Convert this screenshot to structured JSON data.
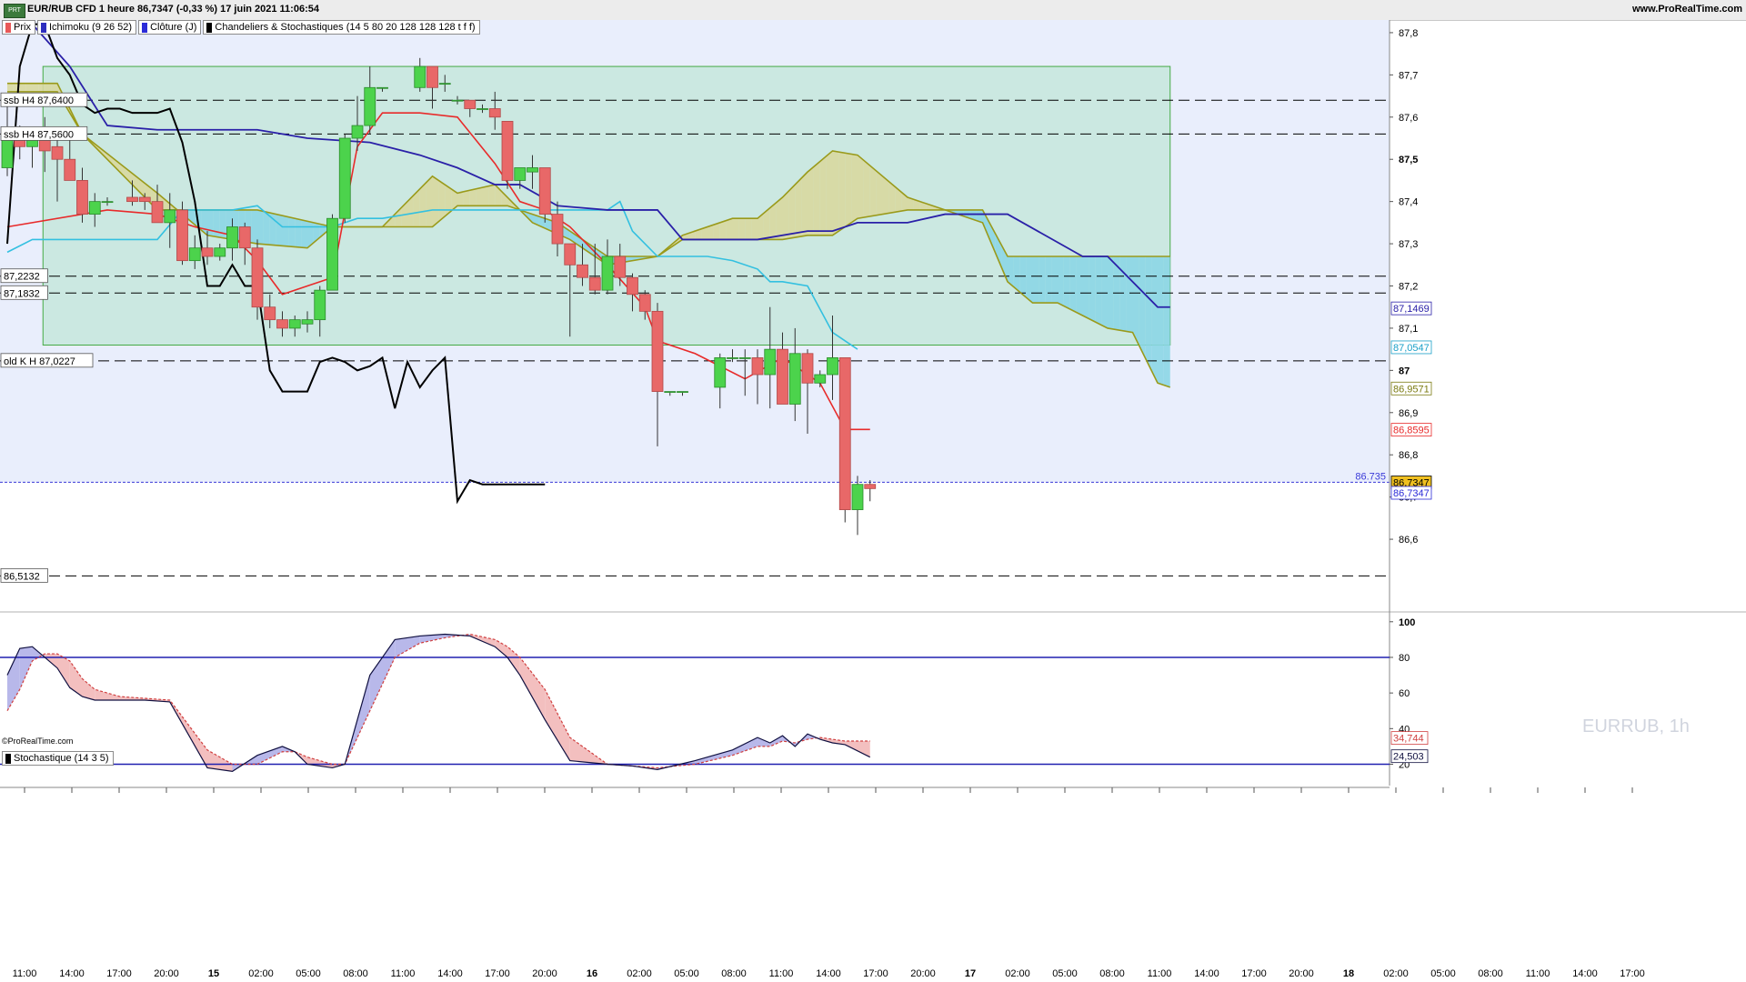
{
  "header": {
    "title": "EUR/RUB CFD 1 heure 86,7347 (-0,33 %) 17 juin 2021 11:06:54",
    "website": "www.ProRealTime.com",
    "logo_text": "PRT"
  },
  "legend": [
    {
      "label": "Prix",
      "color": "#e85858"
    },
    {
      "label": "Ichimoku (9 26 52)",
      "color": "#2d2dbe"
    },
    {
      "label": "Clôture (J)",
      "color": "#2b2bd8"
    },
    {
      "label": "Chandeliers & Stochastiques (14 5 80 20 128 128 128 t f f)",
      "color": "#000000"
    }
  ],
  "stoch_legend": {
    "label": "Stochastique (14 3 5)",
    "color": "#000000"
  },
  "copyright": "©ProRealTime.com",
  "watermark": "EURRUB, 1h",
  "colors": {
    "bull": "#4cd34c",
    "bear": "#e86868",
    "tenkan": "#e82a2a",
    "kijun": "#2a20a8",
    "chikou": "#000000",
    "ssa": "#9a9a1a",
    "ssb": "#9a9a1a",
    "kumo_bull": "#d8d8a0",
    "kumo_bear": "#8cd6e6",
    "bg_plot": "#e9eefc",
    "cyan": "#33c0e0",
    "zone": "#c6e6dc",
    "stoch_k": "#101040",
    "stoch_d": "#d04040"
  },
  "chart_data": [
    {
      "type": "candlestick",
      "title": "EUR/RUB CFD 1 heure",
      "ylim": [
        86.43,
        87.83
      ],
      "x_labels": [
        "11:00",
        "14:00",
        "17:00",
        "20:00",
        "15",
        "02:00",
        "05:00",
        "08:00",
        "11:00",
        "14:00",
        "17:00",
        "20:00",
        "16",
        "02:00",
        "05:00",
        "08:00",
        "11:00",
        "14:00",
        "17:00",
        "20:00",
        "17",
        "02:00",
        "05:00",
        "08:00",
        "11:00",
        "14:00",
        "17:00",
        "20:00",
        "18",
        "02:00",
        "05:00",
        "08:00",
        "11:00",
        "14:00",
        "17:00"
      ],
      "y_ticks": [
        "87,8",
        "87,7",
        "87,6",
        "87,5",
        "87,4",
        "87,3",
        "87,2",
        "87,1",
        "87",
        "86,9",
        "86,8",
        "86,7",
        "86,6"
      ],
      "candles": [
        [
          0,
          87.48,
          87.64,
          87.46,
          87.55
        ],
        [
          1,
          87.55,
          87.58,
          87.5,
          87.53
        ],
        [
          2,
          87.53,
          87.57,
          87.48,
          87.56
        ],
        [
          3,
          87.56,
          87.6,
          87.47,
          87.52
        ],
        [
          4,
          87.53,
          87.55,
          87.4,
          87.5
        ],
        [
          5,
          87.5,
          87.56,
          87.47,
          87.45
        ],
        [
          6,
          87.45,
          87.48,
          87.35,
          87.37
        ],
        [
          7,
          87.37,
          87.42,
          87.34,
          87.4
        ],
        [
          8,
          87.4,
          87.41,
          87.39,
          87.4
        ],
        [
          10,
          87.41,
          87.45,
          87.39,
          87.4
        ],
        [
          11,
          87.41,
          87.42,
          87.38,
          87.4
        ],
        [
          12,
          87.4,
          87.44,
          87.38,
          87.35
        ],
        [
          13,
          87.35,
          87.42,
          87.29,
          87.38
        ],
        [
          14,
          87.38,
          87.4,
          87.25,
          87.26
        ],
        [
          15,
          87.26,
          87.32,
          87.24,
          87.29
        ],
        [
          16,
          87.29,
          87.33,
          87.25,
          87.27
        ],
        [
          17,
          87.27,
          87.3,
          87.26,
          87.29
        ],
        [
          18,
          87.29,
          87.36,
          87.26,
          87.34
        ],
        [
          19,
          87.34,
          87.35,
          87.25,
          87.29
        ],
        [
          20,
          87.29,
          87.31,
          87.12,
          87.15
        ],
        [
          21,
          87.15,
          87.18,
          87.1,
          87.12
        ],
        [
          22,
          87.12,
          87.14,
          87.08,
          87.1
        ],
        [
          23,
          87.1,
          87.13,
          87.08,
          87.12
        ],
        [
          24,
          87.11,
          87.14,
          87.09,
          87.12
        ],
        [
          25,
          87.12,
          87.2,
          87.08,
          87.19
        ],
        [
          26,
          87.19,
          87.37,
          87.19,
          87.36
        ],
        [
          27,
          87.36,
          87.56,
          87.35,
          87.55
        ],
        [
          28,
          87.55,
          87.65,
          87.52,
          87.58
        ],
        [
          29,
          87.58,
          87.72,
          87.56,
          87.67
        ],
        [
          30,
          87.67,
          87.67,
          87.66,
          87.67
        ],
        [
          33,
          87.67,
          87.74,
          87.66,
          87.72
        ],
        [
          34,
          87.72,
          87.72,
          87.62,
          87.67
        ],
        [
          35,
          87.68,
          87.7,
          87.66,
          87.68
        ],
        [
          36,
          87.64,
          87.65,
          87.63,
          87.64
        ],
        [
          37,
          87.64,
          87.64,
          87.6,
          87.62
        ],
        [
          38,
          87.62,
          87.63,
          87.61,
          87.62
        ],
        [
          39,
          87.62,
          87.66,
          87.57,
          87.6
        ],
        [
          40,
          87.59,
          87.59,
          87.43,
          87.45
        ],
        [
          41,
          87.45,
          87.48,
          87.43,
          87.48
        ],
        [
          42,
          87.47,
          87.51,
          87.43,
          87.48
        ],
        [
          43,
          87.48,
          87.48,
          87.35,
          87.37
        ],
        [
          44,
          87.37,
          87.4,
          87.27,
          87.3
        ],
        [
          45,
          87.3,
          87.3,
          87.08,
          87.25
        ],
        [
          46,
          87.25,
          87.3,
          87.2,
          87.22
        ],
        [
          47,
          87.22,
          87.3,
          87.18,
          87.19
        ],
        [
          48,
          87.19,
          87.31,
          87.18,
          87.27
        ],
        [
          49,
          87.27,
          87.3,
          87.2,
          87.22
        ],
        [
          50,
          87.22,
          87.23,
          87.14,
          87.18
        ],
        [
          51,
          87.18,
          87.19,
          87.12,
          87.14
        ],
        [
          52,
          87.14,
          87.16,
          86.82,
          86.95
        ],
        [
          53,
          86.95,
          86.95,
          86.94,
          86.95
        ],
        [
          54,
          86.95,
          86.95,
          86.94,
          86.95
        ],
        [
          57,
          86.96,
          87.04,
          86.91,
          87.03
        ],
        [
          58,
          87.03,
          87.05,
          87.02,
          87.03
        ],
        [
          59,
          87.03,
          87.05,
          86.94,
          87.03
        ],
        [
          60,
          87.03,
          87.05,
          86.92,
          86.99
        ],
        [
          61,
          86.99,
          87.15,
          86.91,
          87.05
        ],
        [
          62,
          87.05,
          87.09,
          86.94,
          86.92
        ],
        [
          63,
          86.92,
          87.1,
          86.88,
          87.04
        ],
        [
          64,
          87.04,
          87.05,
          86.85,
          86.97
        ],
        [
          65,
          86.97,
          87.0,
          86.96,
          86.99
        ],
        [
          66,
          86.99,
          87.13,
          86.93,
          87.03
        ],
        [
          67,
          87.03,
          87.03,
          86.64,
          86.67
        ],
        [
          68,
          86.67,
          86.75,
          86.61,
          86.73
        ],
        [
          69,
          86.73,
          86.74,
          86.69,
          86.72
        ]
      ],
      "tenkan": {
        "x": [
          0,
          8,
          12,
          15,
          18,
          20,
          22,
          24,
          26,
          28,
          30,
          33,
          36,
          39,
          41,
          43,
          45,
          48,
          51,
          52,
          55,
          59,
          62,
          65,
          67,
          69
        ],
        "y": [
          87.34,
          87.38,
          87.37,
          87.34,
          87.32,
          87.26,
          87.18,
          87.2,
          87.22,
          87.53,
          87.61,
          87.61,
          87.6,
          87.49,
          87.4,
          87.38,
          87.34,
          87.25,
          87.15,
          87.07,
          87.04,
          86.98,
          87.03,
          86.97,
          86.86,
          86.86
        ]
      },
      "kijun": {
        "x": [
          0,
          2,
          5,
          8,
          12,
          20,
          24,
          29,
          33,
          36,
          39,
          41,
          44,
          48,
          52,
          54,
          58,
          60,
          64,
          66,
          68,
          72,
          75,
          80,
          86,
          88,
          92,
          93
        ],
        "y": [
          87.85,
          87.82,
          87.72,
          87.58,
          87.57,
          87.57,
          87.55,
          87.54,
          87.51,
          87.48,
          87.44,
          87.44,
          87.39,
          87.38,
          87.38,
          87.31,
          87.31,
          87.31,
          87.33,
          87.33,
          87.35,
          87.35,
          87.37,
          87.37,
          87.27,
          87.27,
          87.15,
          87.15
        ]
      },
      "ssa": {
        "x": [
          0,
          4,
          6,
          12,
          16,
          20,
          24,
          26,
          30,
          34,
          36,
          39,
          42,
          45,
          48,
          52,
          54,
          58,
          60,
          62,
          64,
          66,
          68,
          72,
          75,
          78,
          80,
          82,
          84,
          86,
          88,
          90,
          92,
          93
        ],
        "y": [
          87.68,
          87.68,
          87.56,
          87.42,
          87.32,
          87.3,
          87.29,
          87.34,
          87.34,
          87.46,
          87.42,
          87.44,
          87.35,
          87.31,
          87.25,
          87.27,
          87.32,
          87.36,
          87.36,
          87.41,
          87.47,
          87.52,
          87.51,
          87.41,
          87.38,
          87.35,
          87.21,
          87.16,
          87.16,
          87.13,
          87.1,
          87.09,
          86.97,
          86.96
        ]
      },
      "ssb": {
        "x": [
          0,
          4,
          6,
          12,
          20,
          26,
          28,
          30,
          34,
          36,
          40,
          42,
          44,
          46,
          48,
          52,
          54,
          58,
          62,
          64,
          66,
          68,
          72,
          74,
          75,
          78,
          80,
          92,
          93
        ],
        "y": [
          87.66,
          87.66,
          87.56,
          87.38,
          87.38,
          87.34,
          87.34,
          87.34,
          87.34,
          87.39,
          87.39,
          87.37,
          87.35,
          87.31,
          87.27,
          87.27,
          87.31,
          87.31,
          87.31,
          87.32,
          87.32,
          87.36,
          87.38,
          87.38,
          87.38,
          87.38,
          87.27,
          87.27,
          87.27
        ]
      },
      "cyan": {
        "x": [
          0,
          2,
          8,
          12,
          14,
          18,
          20,
          22,
          24,
          26,
          28,
          30,
          34,
          36,
          40,
          42,
          44,
          46,
          48,
          49,
          50,
          52,
          56,
          58,
          60,
          61,
          62,
          64,
          66,
          68
        ],
        "y": [
          87.28,
          87.31,
          87.31,
          87.31,
          87.38,
          87.38,
          87.39,
          87.34,
          87.34,
          87.34,
          87.36,
          87.36,
          87.38,
          87.38,
          87.38,
          87.38,
          87.38,
          87.38,
          87.38,
          87.4,
          87.33,
          87.27,
          87.27,
          87.26,
          87.24,
          87.21,
          87.21,
          87.2,
          87.09,
          87.05
        ]
      },
      "chikou": {
        "x": [
          0,
          1,
          2,
          3,
          4,
          5,
          6,
          7,
          8,
          9,
          10,
          12,
          13,
          14,
          15,
          16,
          17,
          18,
          19,
          20,
          21,
          22,
          23,
          24,
          25,
          26,
          27,
          28,
          29,
          30,
          31,
          32,
          33,
          34,
          35,
          36,
          37,
          38,
          39,
          40,
          41,
          42,
          43
        ],
        "y": [
          87.3,
          87.72,
          87.82,
          87.82,
          87.74,
          87.7,
          87.63,
          87.61,
          87.62,
          87.62,
          87.61,
          87.61,
          87.62,
          87.54,
          87.4,
          87.2,
          87.2,
          87.25,
          87.2,
          87.2,
          87.0,
          86.95,
          86.95,
          86.95,
          87.02,
          87.03,
          87.02,
          87.0,
          87.01,
          87.03,
          86.91,
          87.02,
          86.96,
          87.0,
          87.03,
          86.69,
          86.74,
          86.73,
          86.73,
          86.73,
          86.73,
          86.73,
          86.73
        ]
      },
      "hlines_dashed": [
        87.64,
        87.56,
        87.2232,
        87.1832,
        87.0227,
        86.5132
      ],
      "hline_blue": {
        "value": 86.735,
        "label": "86.735"
      },
      "rect_zone": {
        "y_top": 87.72,
        "y_bottom": 87.06,
        "x_start": 3,
        "x_end": 93
      },
      "left_labels": [
        {
          "text": "ssb H4 87,6400",
          "y": 87.64
        },
        {
          "text": "ssb H4 87,5600",
          "y": 87.56
        },
        {
          "text": "87,2232",
          "y": 87.2232
        },
        {
          "text": "87,1832",
          "y": 87.1832
        },
        {
          "text": "old K H 87,0227",
          "y": 87.0227
        },
        {
          "text": "86,5132",
          "y": 86.5132
        }
      ],
      "right_badges": [
        {
          "text": "87,1469",
          "y": 87.1469,
          "color": "#2a20a8",
          "bg": "#ffffff"
        },
        {
          "text": "87,0547",
          "y": 87.0547,
          "color": "#1aa0c8",
          "bg": "#ffffff"
        },
        {
          "text": "86,9571",
          "y": 86.9571,
          "color": "#7a7a10",
          "bg": "#ffffff"
        },
        {
          "text": "86,8595",
          "y": 86.8595,
          "color": "#e82a2a",
          "bg": "#ffffff"
        },
        {
          "text": "86,7347",
          "y": 86.7347,
          "color": "#000000",
          "bg": "#f0c020"
        },
        {
          "text": "86,7347",
          "y": 86.71,
          "color": "#2b2bd8",
          "bg": "#ffffff"
        }
      ]
    },
    {
      "type": "line",
      "title": "Stochastique (14 3 5)",
      "ylim": [
        8,
        105
      ],
      "y_ticks": [
        "100",
        "80",
        "60",
        "40",
        "20"
      ],
      "hlines": [
        80,
        20
      ],
      "k": {
        "x": [
          0,
          1,
          2,
          3,
          4,
          5,
          6,
          7,
          9,
          11,
          13,
          16,
          18,
          20,
          22,
          23,
          24,
          26,
          27,
          29,
          31,
          33,
          35,
          37,
          39,
          40,
          41,
          43,
          45,
          48,
          50,
          52,
          55,
          58,
          60,
          61,
          62,
          63,
          64,
          65,
          66,
          67,
          69
        ],
        "y": [
          70,
          85,
          86,
          80,
          74,
          63,
          58,
          56,
          56,
          56,
          55,
          18,
          16,
          25,
          30,
          27,
          20,
          18,
          20,
          70,
          90,
          92,
          93,
          92,
          86,
          80,
          70,
          45,
          22,
          20,
          19,
          17,
          22,
          28,
          35,
          32,
          36,
          30,
          37,
          34,
          32,
          31,
          24
        ]
      },
      "d": {
        "x": [
          0,
          1,
          2,
          3,
          4,
          5,
          6,
          7,
          9,
          11,
          13,
          16,
          18,
          20,
          22,
          23,
          24,
          26,
          27,
          29,
          31,
          33,
          35,
          37,
          39,
          40,
          41,
          43,
          45,
          48,
          50,
          52,
          55,
          58,
          60,
          61,
          62,
          63,
          64,
          65,
          66,
          67,
          69
        ],
        "y": [
          50,
          62,
          78,
          82,
          82,
          78,
          68,
          62,
          58,
          57,
          56,
          28,
          20,
          20,
          27,
          27,
          24,
          20,
          20,
          50,
          80,
          88,
          91,
          93,
          90,
          86,
          80,
          62,
          35,
          20,
          19,
          18,
          20,
          25,
          30,
          30,
          33,
          32,
          34,
          35,
          34,
          33,
          33
        ]
      },
      "right_badges": [
        {
          "text": "34,744",
          "y": 34.744,
          "color": "#d04040"
        },
        {
          "text": "24,503",
          "y": 24.503,
          "color": "#101040"
        }
      ]
    }
  ]
}
